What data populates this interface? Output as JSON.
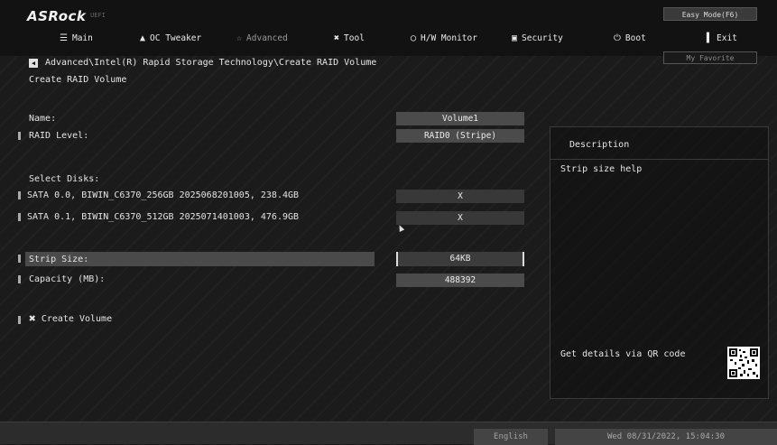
{
  "header": {
    "logo": "ASRock",
    "logo_sub": "UEFI",
    "easy_mode": "Easy Mode(F6)",
    "my_favorite": "My Favorite"
  },
  "nav": [
    {
      "label": "Main",
      "icon": "list-icon",
      "active": false
    },
    {
      "label": "OC Tweaker",
      "icon": "rocket-icon",
      "active": false
    },
    {
      "label": "Advanced",
      "icon": "star-icon",
      "active": true
    },
    {
      "label": "Tool",
      "icon": "tools-icon",
      "active": false
    },
    {
      "label": "H/W Monitor",
      "icon": "monitor-icon",
      "active": false
    },
    {
      "label": "Security",
      "icon": "shield-icon",
      "active": false
    },
    {
      "label": "Boot",
      "icon": "power-icon",
      "active": false
    },
    {
      "label": "Exit",
      "icon": "exit-icon",
      "active": false
    }
  ],
  "breadcrumb": "Advanced\\Intel(R) Rapid Storage Technology\\Create RAID Volume",
  "page_title": "Create RAID Volume",
  "settings": {
    "name_label": "Name:",
    "name_value": "Volume1",
    "raid_level_label": "RAID Level:",
    "raid_level_value": "RAID0 (Stripe)",
    "select_disks_label": "Select Disks:",
    "disks": [
      {
        "label": "SATA 0.0, BIWIN_C6370_256GB 2025068201005, 238.4GB",
        "value": "X"
      },
      {
        "label": "SATA 0.1, BIWIN_C6370_512GB 2025071401003, 476.9GB",
        "value": "X"
      }
    ],
    "strip_size_label": "Strip Size:",
    "strip_size_value": "64KB",
    "capacity_label": "Capacity (MB):",
    "capacity_value": "488392",
    "create_volume_label": "Create Volume"
  },
  "description": {
    "title": "Description",
    "help": "Strip size help",
    "qr_label": "Get details via QR code"
  },
  "footer": {
    "language": "English",
    "datetime": "Wed 08/31/2022, 15:04:30"
  },
  "colors": {
    "background": "#1b1b1b",
    "value_box": "#4b4b4b",
    "selection": "#4a4a4a"
  }
}
